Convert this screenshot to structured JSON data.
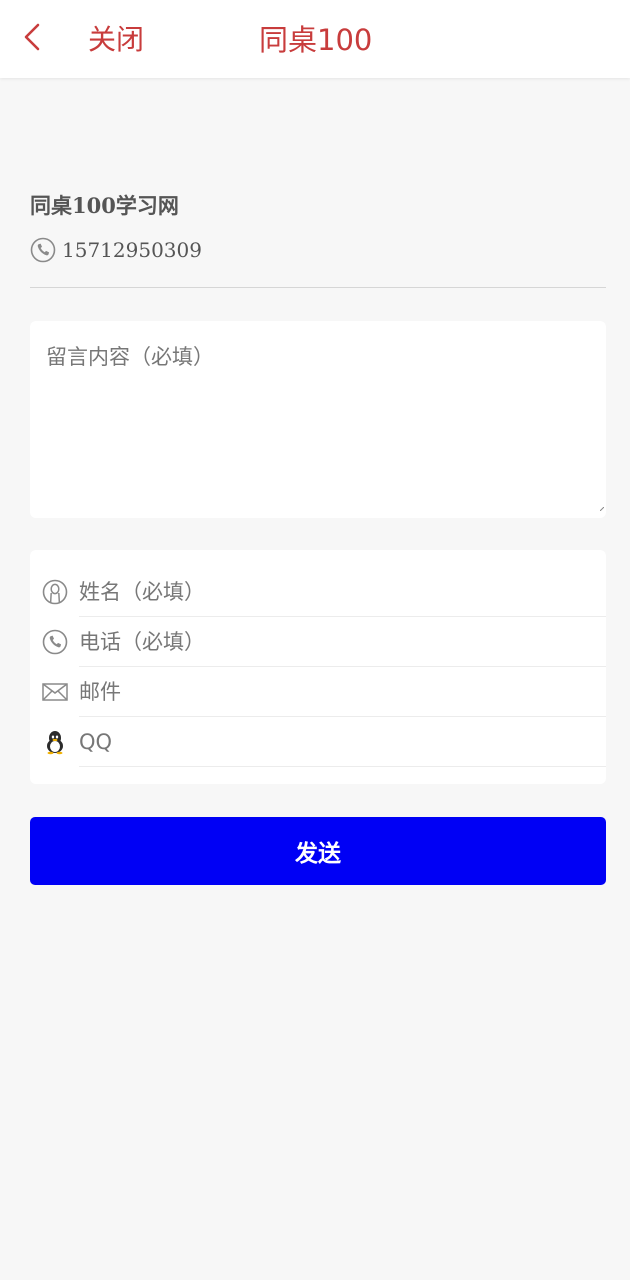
{
  "header": {
    "close_label": "关闭",
    "title": "同桌100",
    "accent_color": "#c83c3c"
  },
  "company": {
    "name": "同桌100学习网",
    "phone": "15712950309"
  },
  "form": {
    "message_placeholder": "留言内容（必填）",
    "fields": [
      {
        "icon": "person-icon",
        "placeholder": "姓名（必填）"
      },
      {
        "icon": "phone-icon",
        "placeholder": "电话（必填）"
      },
      {
        "icon": "mail-icon",
        "placeholder": "邮件"
      },
      {
        "icon": "qq-penguin-icon",
        "placeholder": "QQ"
      }
    ],
    "submit_label": "发送",
    "submit_color": "#0000f5"
  }
}
